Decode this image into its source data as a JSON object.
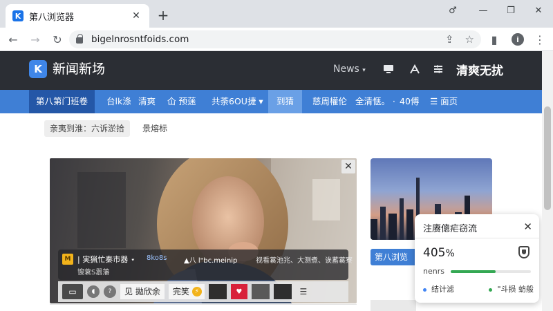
{
  "browser": {
    "tab_title": "第八浏览器",
    "tab_favicon": "K",
    "tab_close": "✕",
    "new_tab": "+",
    "url": "bigelnrosntfoids.com",
    "window_buttons": [
      "♂",
      "—",
      "❐",
      "✕"
    ],
    "nav_buttons": {
      "back": "←",
      "forward": "→",
      "reload": "↻"
    },
    "omnibox_icons": {
      "share": "⇪",
      "bookmark": "☆"
    },
    "extensions": {
      "sidebar": "▮",
      "info": "i",
      "menu": "⋮"
    }
  },
  "site": {
    "logo_letter": "K",
    "name": "新闻新场",
    "news_link": "News",
    "cta": "清爽无扰",
    "header_icons": [
      "monitor-icon",
      "share-icon",
      "settings-icon"
    ],
    "nav": [
      {
        "label": "第八第门班卷"
      },
      {
        "label": "台lk涤"
      },
      {
        "label": "清爽"
      },
      {
        "label": "仚  预蒾"
      },
      {
        "label": "共荼6OU捷 ▾"
      },
      {
        "label": "到猜"
      },
      {
        "label": "慈周權伦"
      },
      {
        "label": "全清惬。 ⋅"
      },
      {
        "label": "40傅"
      },
      {
        "label": "☰   面页"
      }
    ],
    "chips": [
      "亲夷到淮：六诉淤拾",
      "景熔标"
    ]
  },
  "hero": {
    "close": "✕",
    "caption_badge": "M",
    "caption_title": "| 実猟忙秦市器 ⋆",
    "caption_mid": "8ko8s",
    "caption_live": "▲八 l\"bc.meinip",
    "caption_right": "视看蓑池兆、大测煮、诶蓄蓑寮",
    "caption_sub": "锼蓑S嚣藩",
    "player": {
      "screen_icon": "▭",
      "circle_a": "◖",
      "circle_b": "?",
      "tag": "见 拋欣余",
      "done": "完笑",
      "bolt": "⚡",
      "heart": "♥",
      "menu": "☰"
    }
  },
  "side": {
    "button_label": "第八浏览",
    "skyline": [
      {
        "h": 30,
        "w": 10
      },
      {
        "h": 48,
        "w": 8
      },
      {
        "h": 38,
        "w": 12
      },
      {
        "h": 60,
        "w": 6
      },
      {
        "h": 44,
        "w": 10
      },
      {
        "h": 90,
        "w": 5
      },
      {
        "h": 34,
        "w": 14
      },
      {
        "h": 52,
        "w": 9
      },
      {
        "h": 28,
        "w": 12
      },
      {
        "h": 40,
        "w": 10
      },
      {
        "h": 64,
        "w": 8
      },
      {
        "h": 36,
        "w": 14
      }
    ]
  },
  "widget": {
    "title": "注赓傯疟窃流",
    "close": "✕",
    "percent": "405",
    "percent_unit": "%",
    "label": "nenrs",
    "progress": 0.56,
    "legend_left": "结计滤",
    "legend_right": "\"斗损 蚄般",
    "colors": {
      "blue": "#4285f4",
      "green": "#34a853"
    }
  },
  "colors": {
    "header_bg": "#2b2e34",
    "nav_bg": "#3f7fd5",
    "nav_active": "#2457a7",
    "accent": "#3f86e8"
  }
}
